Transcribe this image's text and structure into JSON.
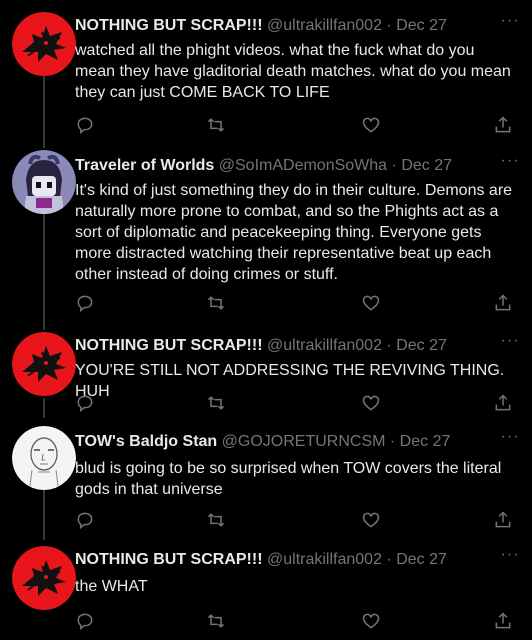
{
  "theme": {
    "background": "#000000",
    "text": "#e7e9ea",
    "muted": "#71767b",
    "line": "#333639"
  },
  "tweets": [
    {
      "name": "NOTHING BUT SCRAP!!!",
      "handle": "@ultrakillfan002",
      "sep": "·",
      "date": "Dec 27",
      "text": "watched all the phight videos. what the fuck what do you mean they have gladitorial death matches. what do you mean they can just COME BACK TO LIFE",
      "avatar": "red-mech-avatar"
    },
    {
      "name": "Traveler of Worlds",
      "handle": "@SoImADemonSoWha",
      "sep": "·",
      "date": "Dec 27",
      "text": "It's kind of just something they do in their culture. Demons are naturally more prone to combat, and so the Phights act as a sort of diplomatic and peacekeeping thing. Everyone gets more distracted watching their representative beat up each other instead of doing crimes or stuff.",
      "avatar": "purple-character-avatar"
    },
    {
      "name": "NOTHING BUT SCRAP!!!",
      "handle": "@ultrakillfan002",
      "sep": "·",
      "date": "Dec 27",
      "text": "YOU'RE STILL NOT ADDRESSING THE REVIVING THING. HUH",
      "avatar": "red-mech-avatar"
    },
    {
      "name": "TOW's Baldjo Stan",
      "handle": "@GOJORETURNCSM",
      "sep": "·",
      "date": "Dec 27",
      "text": "blud is going to be so surprised when TOW covers the literal gods in that universe",
      "avatar": "sketch-face-avatar"
    },
    {
      "name": "NOTHING BUT SCRAP!!!",
      "handle": "@ultrakillfan002",
      "sep": "·",
      "date": "Dec 27",
      "text": "the WHAT",
      "avatar": "red-mech-avatar"
    }
  ],
  "actions": {
    "reply": "reply-icon",
    "retweet": "retweet-icon",
    "like": "like-icon",
    "share": "share-icon",
    "more": "more-icon"
  }
}
